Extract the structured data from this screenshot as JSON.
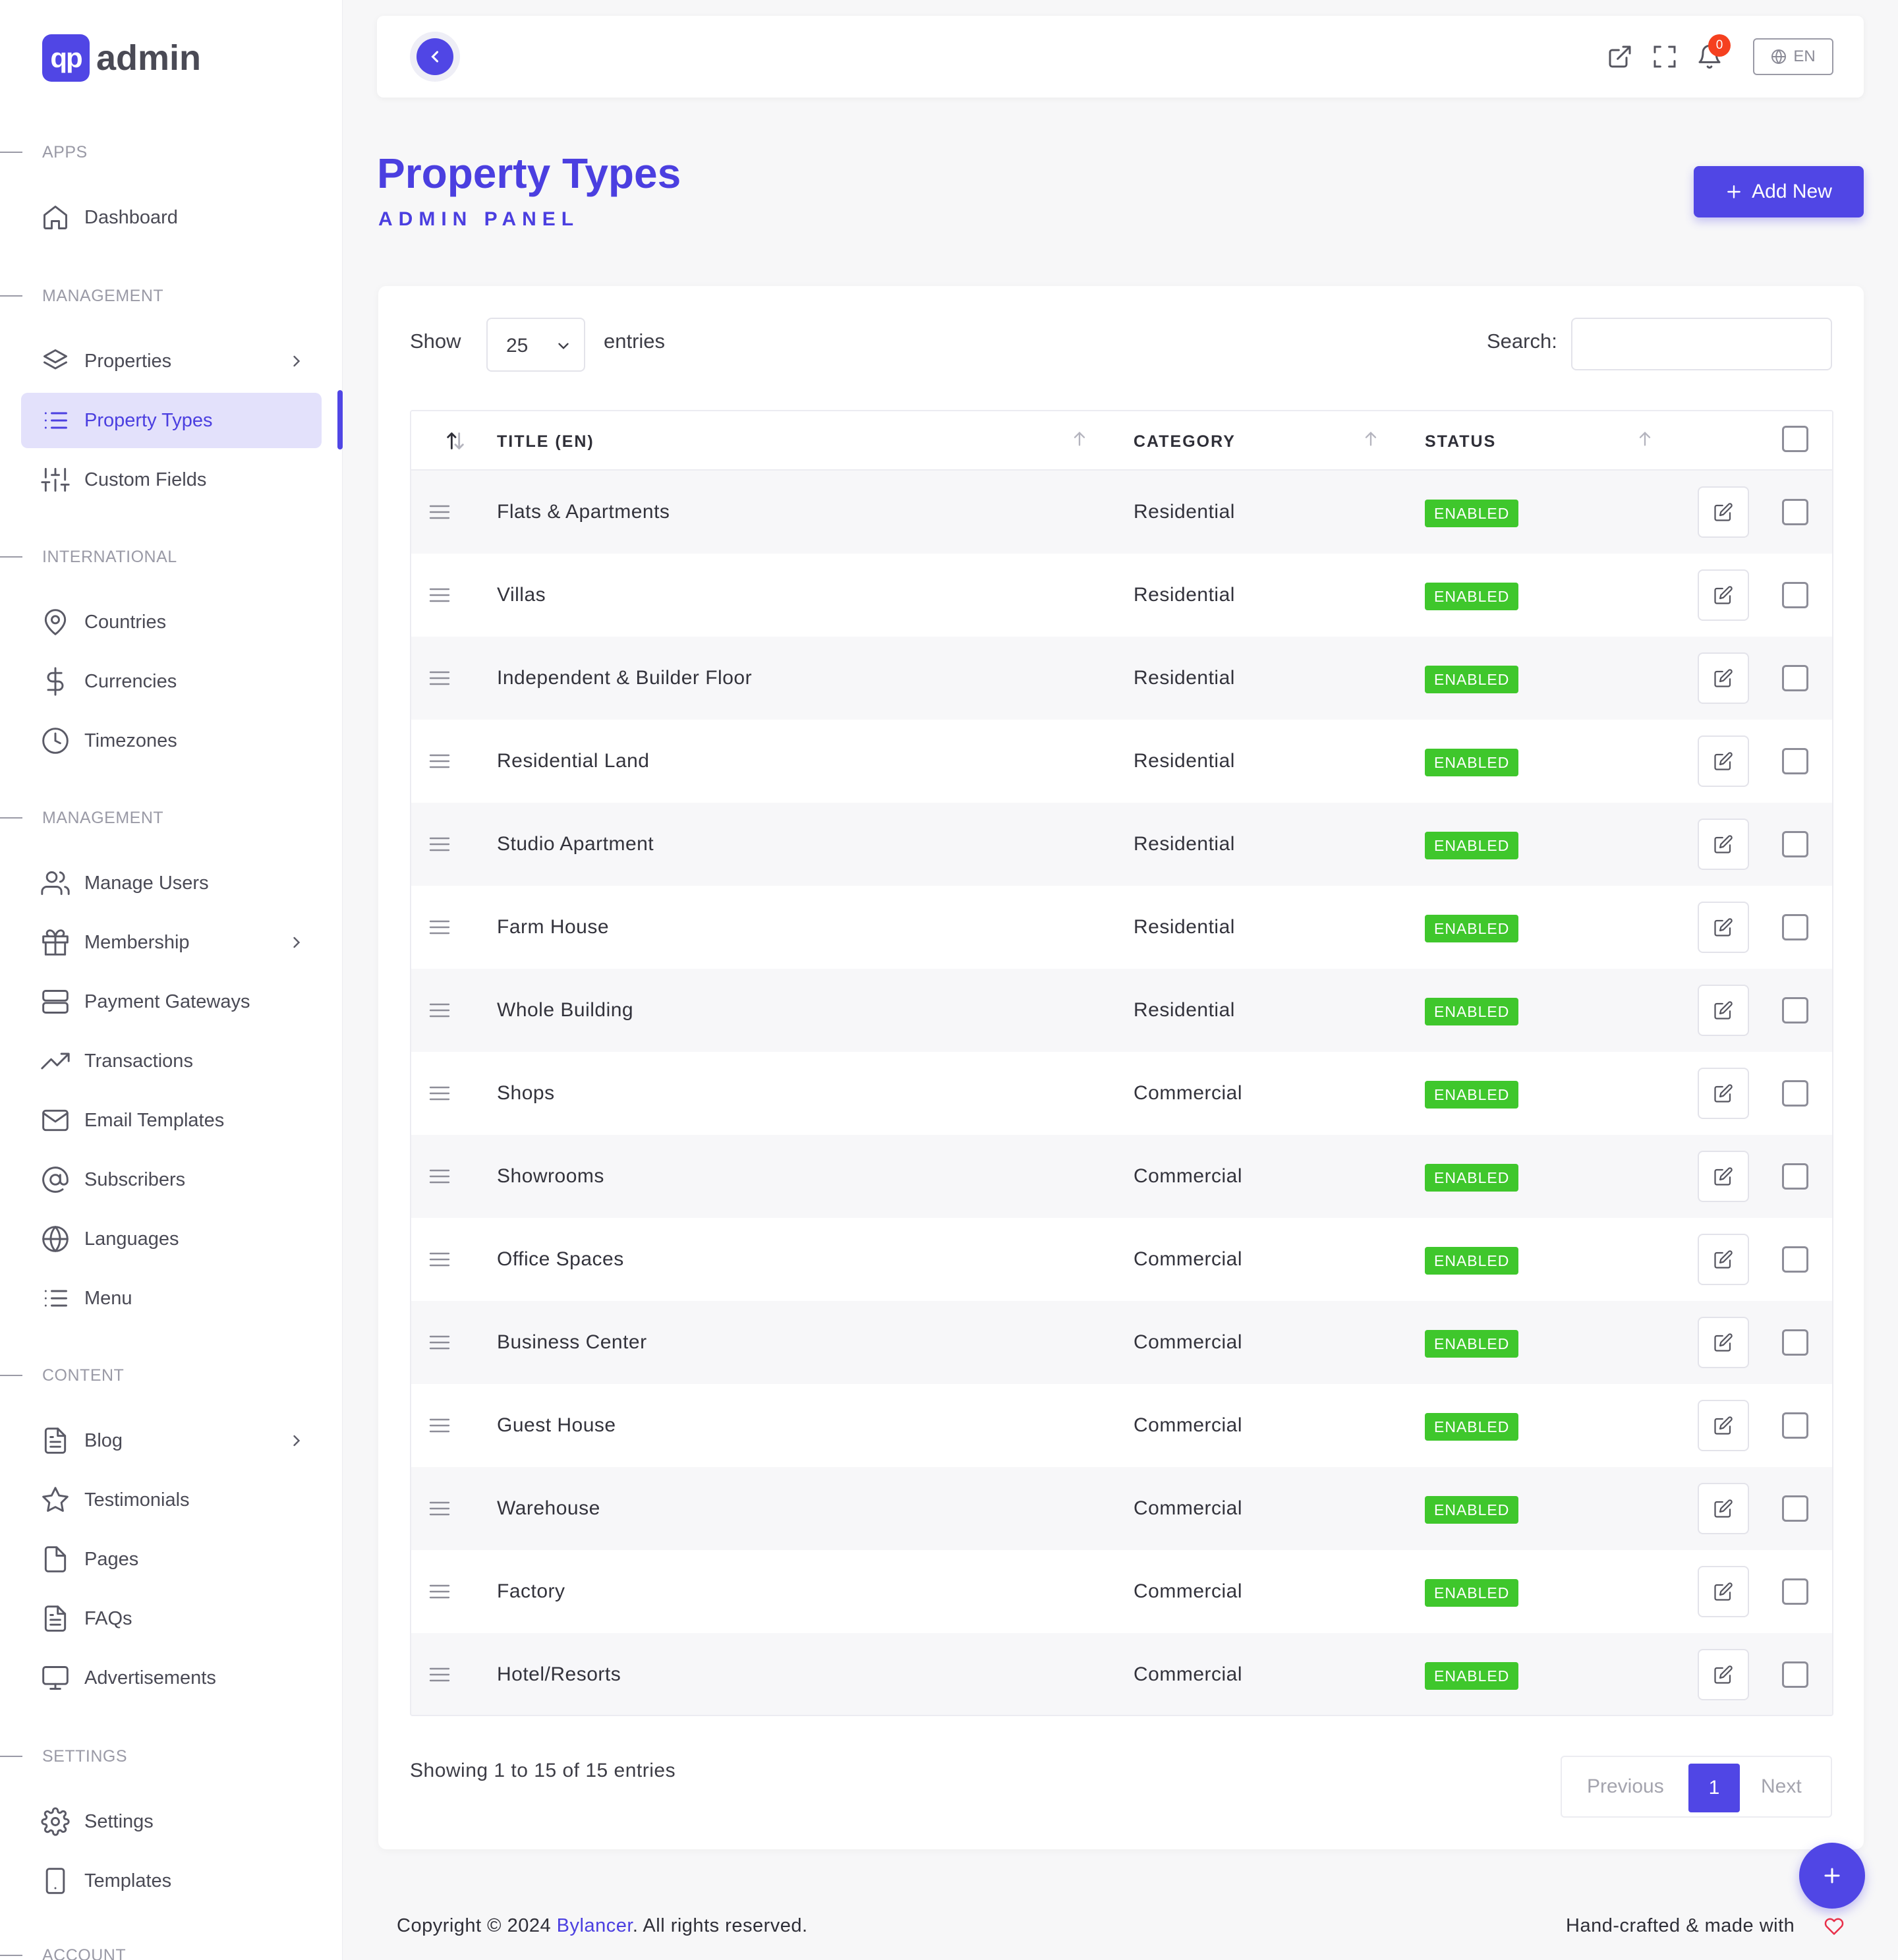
{
  "brand": {
    "logo_mark": "qp",
    "logo_text": "admin"
  },
  "sidebar": {
    "sections": {
      "apps": "APPS",
      "management": "MANAGEMENT",
      "international": "INTERNATIONAL",
      "management2": "MANAGEMENT",
      "content": "CONTENT",
      "settings": "SETTINGS",
      "account": "ACCOUNT"
    },
    "items": {
      "dashboard": {
        "label": "Dashboard",
        "icon": "home-icon"
      },
      "properties": {
        "label": "Properties",
        "icon": "layers-icon"
      },
      "property_types": {
        "label": "Property Types",
        "icon": "list-icon",
        "active": true
      },
      "custom_fields": {
        "label": "Custom Fields",
        "icon": "sliders-icon"
      },
      "countries": {
        "label": "Countries",
        "icon": "map-pin-icon"
      },
      "currencies": {
        "label": "Currencies",
        "icon": "dollar-icon"
      },
      "timezones": {
        "label": "Timezones",
        "icon": "clock-icon"
      },
      "manage_users": {
        "label": "Manage Users",
        "icon": "users-icon"
      },
      "membership": {
        "label": "Membership",
        "icon": "gift-icon"
      },
      "payment_gateways": {
        "label": "Payment Gateways",
        "icon": "server-icon"
      },
      "transactions": {
        "label": "Transactions",
        "icon": "trending-up-icon"
      },
      "email_templates": {
        "label": "Email Templates",
        "icon": "mail-icon"
      },
      "subscribers": {
        "label": "Subscribers",
        "icon": "at-sign-icon"
      },
      "languages": {
        "label": "Languages",
        "icon": "globe-icon"
      },
      "menu": {
        "label": "Menu",
        "icon": "list-icon"
      },
      "blog": {
        "label": "Blog",
        "icon": "file-text-icon"
      },
      "testimonials": {
        "label": "Testimonials",
        "icon": "star-icon"
      },
      "pages": {
        "label": "Pages",
        "icon": "file-icon"
      },
      "faqs": {
        "label": "FAQs",
        "icon": "file-text-icon"
      },
      "advertisements": {
        "label": "Advertisements",
        "icon": "monitor-icon"
      },
      "settings": {
        "label": "Settings",
        "icon": "gear-icon"
      },
      "templates": {
        "label": "Templates",
        "icon": "tablet-icon"
      }
    }
  },
  "topbar": {
    "notification_count": "0",
    "language": "EN"
  },
  "header": {
    "title": "Property Types",
    "subtitle": "ADMIN PANEL",
    "add_button": "Add New"
  },
  "table_controls": {
    "show_label": "Show",
    "page_size": "25",
    "entries_label": "entries",
    "search_label": "Search:",
    "search_value": ""
  },
  "table": {
    "columns": {
      "title": "TITLE (EN)",
      "category": "CATEGORY",
      "status": "STATUS"
    },
    "rows": [
      {
        "title": "Flats & Apartments",
        "category": "Residential",
        "status": "ENABLED"
      },
      {
        "title": "Villas",
        "category": "Residential",
        "status": "ENABLED"
      },
      {
        "title": "Independent & Builder Floor",
        "category": "Residential",
        "status": "ENABLED"
      },
      {
        "title": "Residential Land",
        "category": "Residential",
        "status": "ENABLED"
      },
      {
        "title": "Studio Apartment",
        "category": "Residential",
        "status": "ENABLED"
      },
      {
        "title": "Farm House",
        "category": "Residential",
        "status": "ENABLED"
      },
      {
        "title": "Whole Building",
        "category": "Residential",
        "status": "ENABLED"
      },
      {
        "title": "Shops",
        "category": "Commercial",
        "status": "ENABLED"
      },
      {
        "title": "Showrooms",
        "category": "Commercial",
        "status": "ENABLED"
      },
      {
        "title": "Office Spaces",
        "category": "Commercial",
        "status": "ENABLED"
      },
      {
        "title": "Business Center",
        "category": "Commercial",
        "status": "ENABLED"
      },
      {
        "title": "Guest House",
        "category": "Commercial",
        "status": "ENABLED"
      },
      {
        "title": "Warehouse",
        "category": "Commercial",
        "status": "ENABLED"
      },
      {
        "title": "Factory",
        "category": "Commercial",
        "status": "ENABLED"
      },
      {
        "title": "Hotel/Resorts",
        "category": "Commercial",
        "status": "ENABLED"
      }
    ]
  },
  "pagination": {
    "info": "Showing 1 to 15 of 15 entries",
    "previous": "Previous",
    "current": "1",
    "next": "Next"
  },
  "footer": {
    "copyright_prefix": "Copyright © 2024 ",
    "company": "Bylancer",
    "copyright_suffix": ". All rights reserved.",
    "handcrafted": "Hand-crafted & made with"
  },
  "colors": {
    "accent": "#5046e5",
    "status_enabled": "#3fc72c",
    "badge": "#f5401f",
    "active_nav_bg": "#e3e1fb"
  }
}
